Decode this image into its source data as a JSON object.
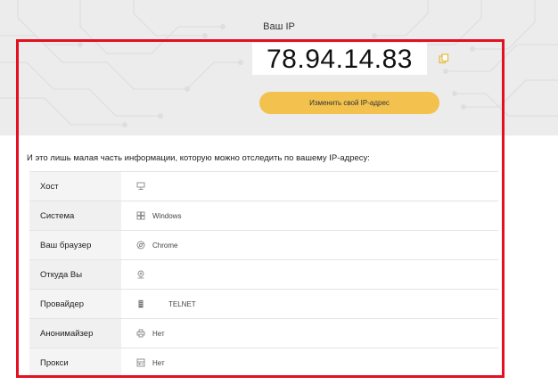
{
  "hero": {
    "title": "Ваш IP",
    "ip": "78.94.14.83",
    "change_button": "Изменить свой IP-адрес"
  },
  "info": {
    "heading": "И это лишь малая часть информации, которую можно отследить по вашему IP-адресу:",
    "rows": [
      {
        "label": "Хост",
        "icon": "server-icon",
        "value": ""
      },
      {
        "label": "Система",
        "icon": "windows-icon",
        "value": "Windows"
      },
      {
        "label": "Ваш браузер",
        "icon": "chrome-icon",
        "value": "Chrome"
      },
      {
        "label": "Откуда Вы",
        "icon": "location-pin-icon",
        "value": ""
      },
      {
        "label": "Провайдер",
        "icon": "building-icon",
        "value": "TELNET"
      },
      {
        "label": "Анонимайзер",
        "icon": "printer-icon",
        "value": "Нет"
      },
      {
        "label": "Прокси",
        "icon": "proxy-icon",
        "value": "Нет"
      }
    ]
  },
  "colors": {
    "accent_button": "#f2c14e",
    "highlight_border": "#e3101f"
  }
}
